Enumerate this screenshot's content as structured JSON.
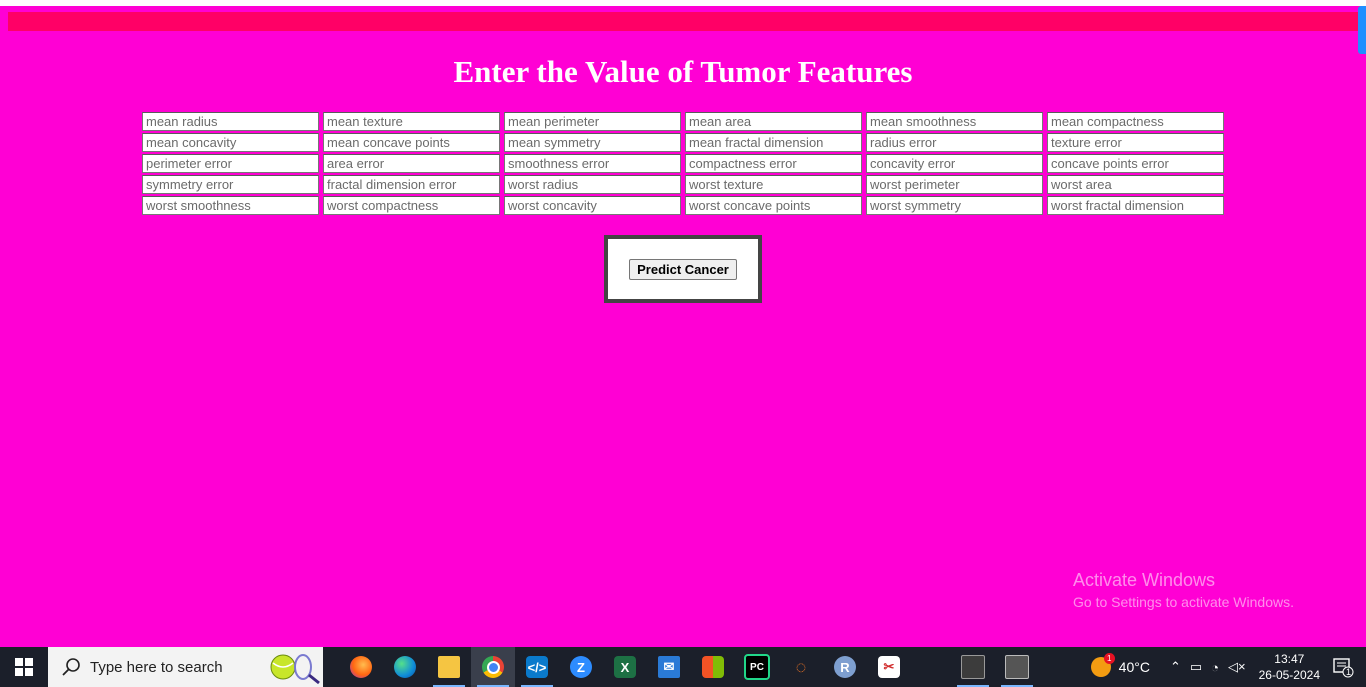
{
  "page": {
    "title": "Enter the Value of Tumor Features",
    "background": "#ff00d4",
    "accent_bar": "#ff0066"
  },
  "form": {
    "fields": [
      "mean radius",
      "mean texture",
      "mean perimeter",
      "mean area",
      "mean smoothness",
      "mean compactness",
      "mean concavity",
      "mean concave points",
      "mean symmetry",
      "mean fractal dimension",
      "radius error",
      "texture error",
      "perimeter error",
      "area error",
      "smoothness error",
      "compactness error",
      "concavity error",
      "concave points error",
      "symmetry error",
      "fractal dimension error",
      "worst radius",
      "worst texture",
      "worst perimeter",
      "worst area",
      "worst smoothness",
      "worst compactness",
      "worst concavity",
      "worst concave points",
      "worst symmetry",
      "worst fractal dimension"
    ],
    "submit_label": "Predict Cancer"
  },
  "watermark": {
    "line1": "Activate Windows",
    "line2": "Go to Settings to activate Windows."
  },
  "taskbar": {
    "search_placeholder": "Type here to search",
    "apps": [
      "firefox-icon",
      "edge-icon",
      "file-explorer-icon",
      "chrome-icon",
      "vscode-icon",
      "zoom-icon",
      "excel-icon",
      "mail-icon",
      "store-icon",
      "pycharm-icon",
      "jupyter-icon",
      "r-icon",
      "snipping-tool-icon",
      "terminal-icon",
      "window-icon"
    ],
    "weather_badge": "1",
    "temperature": "40°C",
    "time": "13:47",
    "date": "26-05-2024",
    "notification_count": "1"
  }
}
